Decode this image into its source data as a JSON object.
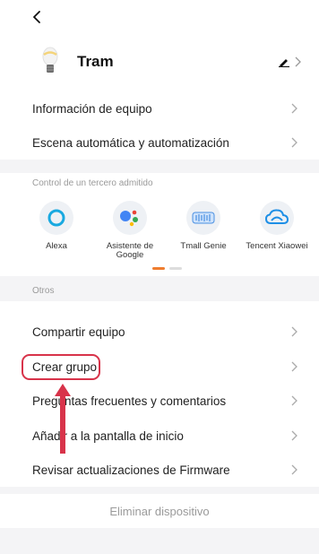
{
  "nav": {
    "back_icon": "chevron-left-icon"
  },
  "device": {
    "name": "Tram",
    "icon": "lightbulb-icon",
    "edit_icon": "pencil-icon"
  },
  "menu_top": [
    {
      "label": "Información de equipo"
    },
    {
      "label": "Escena automática y automatización"
    }
  ],
  "third_party": {
    "section_label": "Control de un tercero admitido",
    "items": [
      {
        "label": "Alexa",
        "icon": "alexa-icon"
      },
      {
        "label": "Asistente de Google",
        "icon": "google-assistant-icon"
      },
      {
        "label": "Tmall Genie",
        "icon": "tmall-genie-icon"
      },
      {
        "label": "Tencent Xiaowei",
        "icon": "tencent-xiaowei-icon"
      }
    ],
    "active_page": 1,
    "page_count": 2
  },
  "others": {
    "section_label": "Otros",
    "items": [
      {
        "label": "Compartir equipo"
      },
      {
        "label": "Crear grupo"
      },
      {
        "label": "Preguntas frecuentes y comentarios"
      },
      {
        "label": "Añadir a la pantalla de inicio"
      },
      {
        "label": "Revisar actualizaciones de Firmware"
      }
    ]
  },
  "delete": {
    "label": "Eliminar dispositivo"
  },
  "colors": {
    "accent": "#ef7d2f",
    "highlight": "#d8334a",
    "background": "#f4f4f6",
    "muted_text": "#9a9a9a"
  }
}
